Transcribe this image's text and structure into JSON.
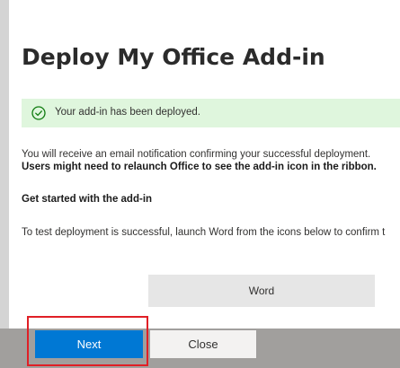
{
  "dialog": {
    "title": "Deploy My Office Add-in"
  },
  "status": {
    "message": "Your add-in has been deployed.",
    "icon": "check-circle-icon",
    "color": "#dff6dd"
  },
  "content": {
    "notification_text": "You will receive an email notification confirming your successful deployment.",
    "relaunch_text": "Users might need to relaunch Office to see the add-in icon in the ribbon.",
    "section_heading": "Get started with the add-in",
    "test_text": "To test deployment is successful, launch Word from the icons below to confirm t"
  },
  "launch_buttons": {
    "word_label": "Word"
  },
  "footer": {
    "next_label": "Next",
    "close_label": "Close",
    "accent": "#0078d4",
    "highlight_color": "#e01f26"
  }
}
